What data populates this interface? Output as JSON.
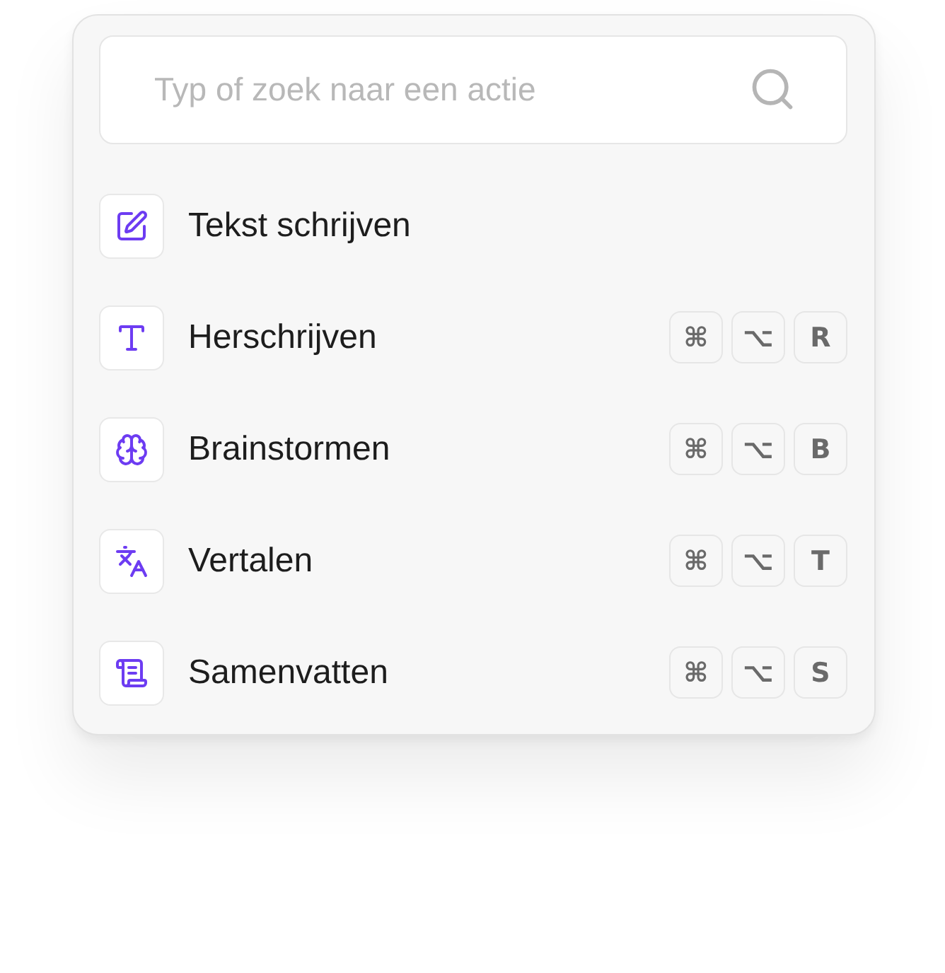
{
  "search": {
    "placeholder": "Typ of zoek naar een actie"
  },
  "actions": [
    {
      "kind": "write",
      "label": "Tekst schrijven"
    },
    {
      "kind": "rewrite",
      "label": "Herschrijven",
      "keys": [
        "⌘",
        "⌥",
        "R"
      ]
    },
    {
      "kind": "brainstorm",
      "label": "Brainstormen",
      "keys": [
        "⌘",
        "⌥",
        "B"
      ]
    },
    {
      "kind": "translate",
      "label": "Vertalen",
      "keys": [
        "⌘",
        "⌥",
        "T"
      ]
    },
    {
      "kind": "summarize",
      "label": "Samenvatten",
      "keys": [
        "⌘",
        "⌥",
        "S"
      ]
    }
  ]
}
